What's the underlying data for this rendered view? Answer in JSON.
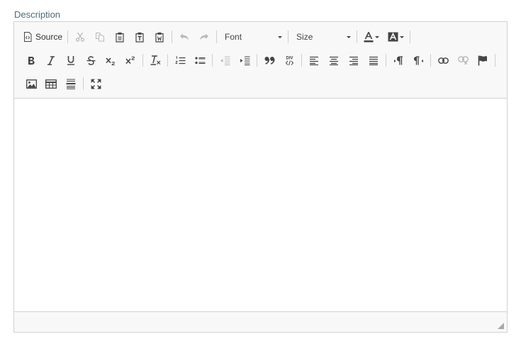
{
  "field": {
    "label": "Description"
  },
  "toolbar": {
    "source_label": "Source",
    "font_combo": {
      "value": "Font"
    },
    "size_combo": {
      "value": "Size"
    },
    "accent_color": "#444444",
    "disabled_color": "#bbbbbb"
  }
}
